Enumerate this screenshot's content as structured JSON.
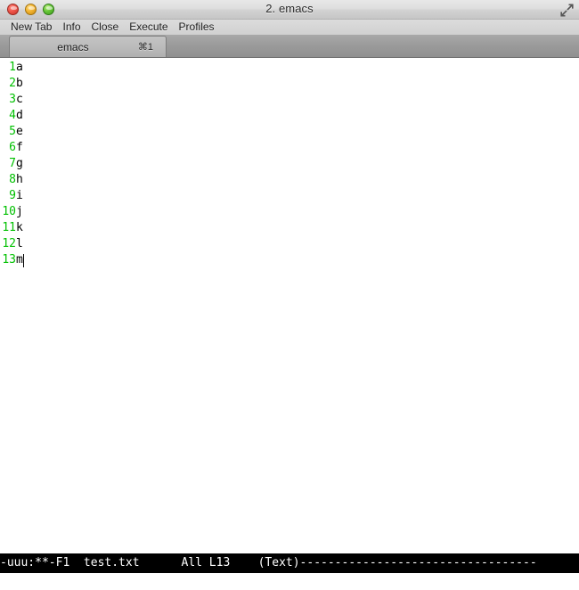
{
  "window": {
    "title": "2. emacs",
    "traffic_lights": [
      {
        "name": "close",
        "color": "#f0564b"
      },
      {
        "name": "minimize",
        "color": "#f5b531"
      },
      {
        "name": "zoom",
        "color": "#68c838"
      }
    ],
    "fullscreen_icon": "fullscreen-expand-icon"
  },
  "menubar": {
    "items": [
      {
        "label": "New Tab"
      },
      {
        "label": "Info"
      },
      {
        "label": "Close"
      },
      {
        "label": "Execute"
      },
      {
        "label": "Profiles"
      }
    ]
  },
  "tabbar": {
    "tabs": [
      {
        "label": "emacs",
        "shortcut": "⌘1",
        "active": true
      }
    ]
  },
  "editor": {
    "line_number_color": "#00c000",
    "text_color": "#000000",
    "background": "#ffffff",
    "lines": [
      {
        "number": "1",
        "text": "a"
      },
      {
        "number": "2",
        "text": "b"
      },
      {
        "number": "3",
        "text": "c"
      },
      {
        "number": "4",
        "text": "d"
      },
      {
        "number": "5",
        "text": "e"
      },
      {
        "number": "6",
        "text": "f"
      },
      {
        "number": "7",
        "text": "g"
      },
      {
        "number": "8",
        "text": "h"
      },
      {
        "number": "9",
        "text": "i"
      },
      {
        "number": "10",
        "text": "j"
      },
      {
        "number": "11",
        "text": "k"
      },
      {
        "number": "12",
        "text": "l"
      },
      {
        "number": "13",
        "text": "m"
      }
    ],
    "cursor_line": 13
  },
  "modeline": {
    "text": "-uuu:**-F1  test.txt      All L13    (Text)----------------------------------",
    "status": "-uuu:**-F1",
    "filename": "test.txt",
    "position": "All L13",
    "mode": "(Text)",
    "foreground": "#ffffff",
    "background": "#000000"
  },
  "minibuffer": {
    "text": ""
  }
}
